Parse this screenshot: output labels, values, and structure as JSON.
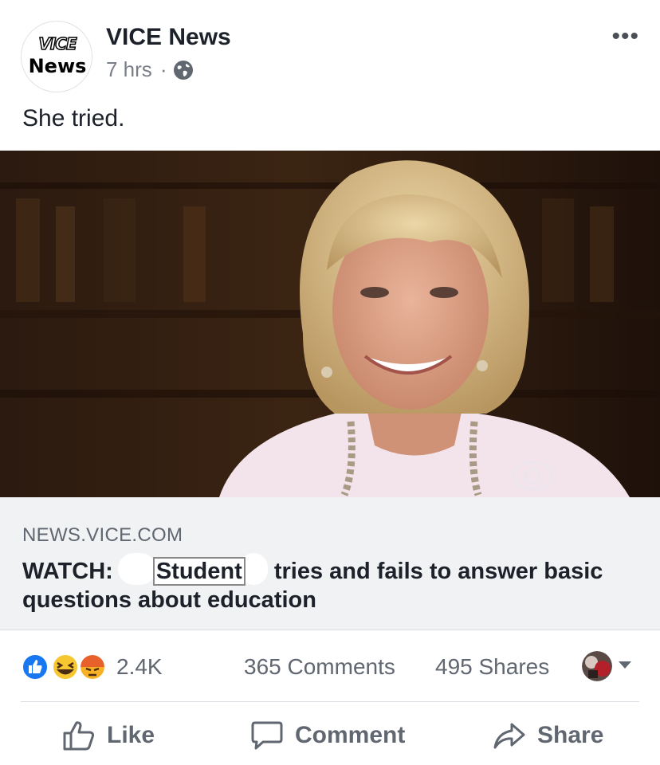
{
  "post": {
    "page_name": "VICE News",
    "avatar_logo_top": "VICE",
    "avatar_logo_bottom": "News",
    "time": "7 hrs",
    "separator": "·",
    "privacy_icon": "globe-icon",
    "more_label": "•••",
    "caption": "She tried."
  },
  "link": {
    "domain": "NEWS.VICE.COM",
    "title_prefix": "WATCH:",
    "title_boxed_word": "Student",
    "title_suffix": "tries and fails to answer basic questions about education",
    "watermark": "CBS-eye-logo"
  },
  "stats": {
    "reaction_icons": [
      "like-reaction-icon",
      "haha-reaction-icon",
      "angry-reaction-icon"
    ],
    "reaction_count": "2.4K",
    "comments": "365 Comments",
    "shares": "495 Shares"
  },
  "actions": {
    "like": "Like",
    "comment": "Comment",
    "share": "Share"
  },
  "colors": {
    "text_primary": "#1d2129",
    "text_secondary": "#606770",
    "like_blue": "#1877f2",
    "link_bg": "#f1f2f4"
  }
}
